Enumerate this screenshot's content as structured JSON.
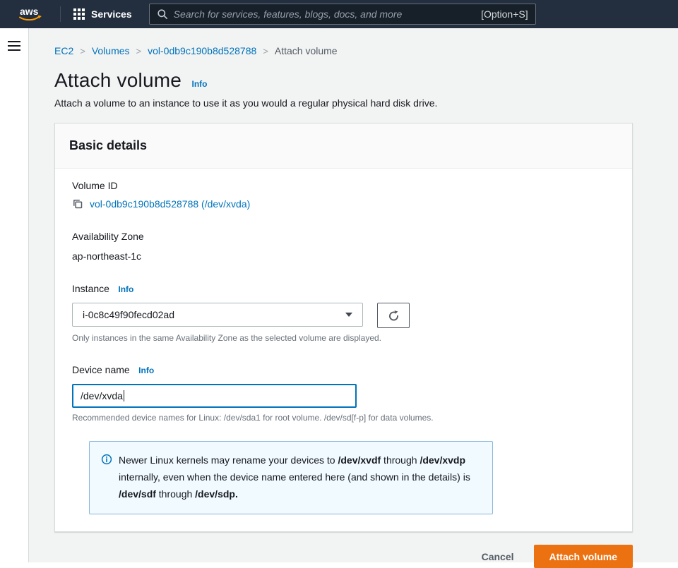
{
  "topbar": {
    "logo": "aws",
    "services_label": "Services",
    "search_placeholder": "Search for services, features, blogs, docs, and more",
    "search_shortcut": "[Option+S]"
  },
  "breadcrumb": {
    "items": [
      {
        "label": "EC2"
      },
      {
        "label": "Volumes"
      },
      {
        "label": "vol-0db9c190b8d528788"
      },
      {
        "label": "Attach volume"
      }
    ]
  },
  "page": {
    "title": "Attach volume",
    "info_label": "Info",
    "description": "Attach a volume to an instance to use it as you would a regular physical hard disk drive."
  },
  "card": {
    "title": "Basic details",
    "volume_id": {
      "label": "Volume ID",
      "value": "vol-0db9c190b8d528788 (/dev/xvda)"
    },
    "availability_zone": {
      "label": "Availability Zone",
      "value": "ap-northeast-1c"
    },
    "instance": {
      "label": "Instance",
      "info_label": "Info",
      "selected": "i-0c8c49f90fecd02ad",
      "helper": "Only instances in the same Availability Zone as the selected volume are displayed."
    },
    "device_name": {
      "label": "Device name",
      "info_label": "Info",
      "value": "/dev/xvda",
      "helper": "Recommended device names for Linux: /dev/sda1 for root volume. /dev/sd[f-p] for data volumes."
    },
    "alert": {
      "segments": [
        {
          "text": "Newer Linux kernels may rename your devices to ",
          "bold": false
        },
        {
          "text": "/dev/xvdf",
          "bold": true
        },
        {
          "text": " through ",
          "bold": false
        },
        {
          "text": "/dev/xvdp",
          "bold": true
        },
        {
          "text": " internally, even when the device name entered here (and shown in the details) is ",
          "bold": false
        },
        {
          "text": "/dev/sdf",
          "bold": true
        },
        {
          "text": " through ",
          "bold": false
        },
        {
          "text": "/dev/sdp.",
          "bold": true
        }
      ]
    }
  },
  "footer": {
    "cancel_label": "Cancel",
    "submit_label": "Attach volume"
  },
  "colors": {
    "topbar_bg": "#232f3e",
    "accent_orange": "#ec7211",
    "logo_orange": "#ff9900",
    "link_blue": "#0073bb",
    "alert_bg": "#f1faff",
    "page_bg": "#f2f3f3"
  }
}
